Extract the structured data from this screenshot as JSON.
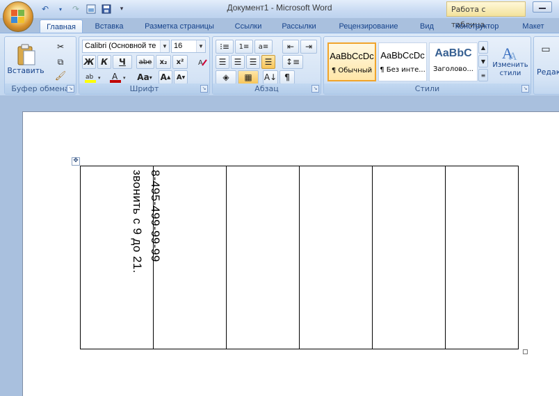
{
  "app": {
    "title": "Документ1 - Microsoft Word",
    "context_title": "Работа с таблица..."
  },
  "qat": {
    "icons": [
      "save-icon",
      "undo-icon",
      "redo-icon",
      "print-preview-icon",
      "customize-qat-icon"
    ]
  },
  "tabs": [
    {
      "label": "Главная",
      "active": true
    },
    {
      "label": "Вставка"
    },
    {
      "label": "Разметка страницы"
    },
    {
      "label": "Ссылки"
    },
    {
      "label": "Рассылки"
    },
    {
      "label": "Рецензирование"
    },
    {
      "label": "Вид"
    },
    {
      "label": "Конструктор"
    },
    {
      "label": "Макет"
    }
  ],
  "ribbon": {
    "clipboard": {
      "label": "Буфер обмена",
      "paste_label": "Вставить"
    },
    "font": {
      "label": "Шрифт",
      "font_name": "Calibri (Основной те",
      "font_size": "16",
      "bold": "Ж",
      "italic": "К",
      "underline": "Ч",
      "strike": "abe",
      "subscript": "x₂",
      "superscript": "x²",
      "case": "Aa",
      "grow": "A",
      "shrink": "A",
      "font_color": "#c00000",
      "highlight_color": "#ffff00"
    },
    "paragraph": {
      "label": "Абзац",
      "pilcrow": "¶"
    },
    "styles": {
      "label": "Стили",
      "items": [
        {
          "sample": "AaBbCcDc",
          "name": "¶ Обычный"
        },
        {
          "sample": "AaBbCcDc",
          "name": "¶ Без инте..."
        },
        {
          "sample": "AaBbC",
          "name": "Заголово..."
        }
      ],
      "change_styles": "Изменить стили"
    },
    "editing": {
      "label": "Редакт"
    }
  },
  "document": {
    "table": {
      "columns": 6,
      "cell1_lines": [
        "8-495-499-99-99",
        "звонить с 9 до 21."
      ]
    }
  },
  "colors": {
    "accent": "#15428b",
    "ribbon": "#dbe8f7",
    "workspace": "#a9c0de"
  }
}
